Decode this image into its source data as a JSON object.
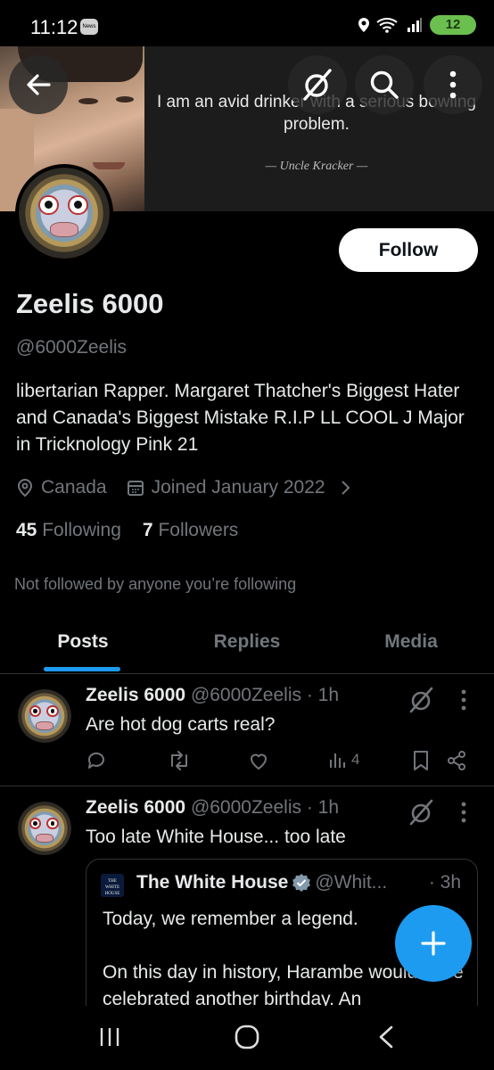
{
  "status_bar": {
    "time": "11:12",
    "news_badge": "News",
    "network_badge": "6",
    "battery": "12"
  },
  "banner": {
    "quote": "I am an avid drinker with a serious bowling problem.",
    "quote_author": "— Uncle Kracker —"
  },
  "profile": {
    "follow_label": "Follow",
    "display_name": "Zeelis 6000",
    "handle": "@6000Zeelis",
    "bio": "libertarian Rapper.  Margaret Thatcher's Biggest Hater and Canada's Biggest Mistake R.I.P LL COOL J Major in Tricknology Pink 21",
    "location": "Canada",
    "joined": "Joined January 2022",
    "following_count": "45",
    "following_label": "Following",
    "followers_count": "7",
    "followers_label": "Followers",
    "not_followed": "Not followed by anyone you’re following"
  },
  "tabs": [
    {
      "label": "Posts",
      "active": true
    },
    {
      "label": "Replies",
      "active": false
    },
    {
      "label": "Media",
      "active": false
    }
  ],
  "posts": [
    {
      "name": "Zeelis 6000",
      "handle": "@6000Zeelis",
      "time": "· 1h",
      "text": "Are hot dog carts real?",
      "views": "4"
    },
    {
      "name": "Zeelis 6000",
      "handle": "@6000Zeelis",
      "time": "· 1h",
      "text": "Too late White House... too late",
      "quote": {
        "logo_text": "THE WHITE HOUSE",
        "name": "The White House",
        "handle": "@Whit...",
        "time": "· 3h",
        "line1": "Today, we remember a legend.",
        "line2": "On this day in history, Harambe would have celebrated another birthday. An"
      }
    }
  ],
  "colors": {
    "accent": "#1d9bf0",
    "muted": "#71767b",
    "text": "#e7e9ea",
    "background": "#000000"
  }
}
